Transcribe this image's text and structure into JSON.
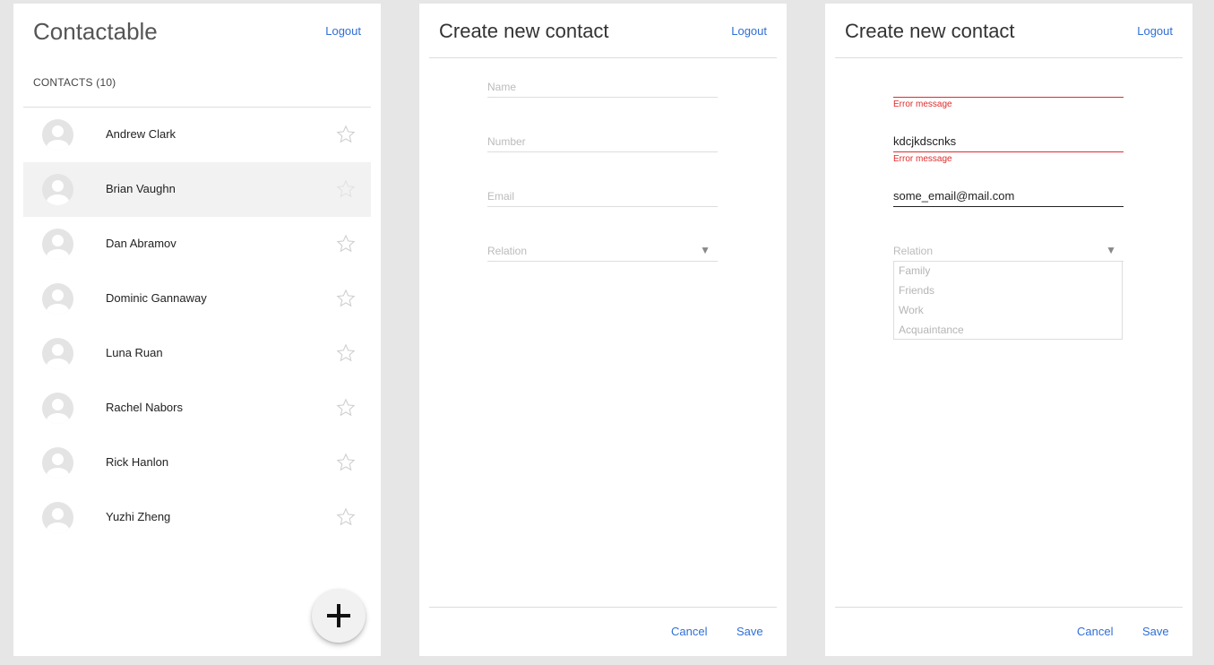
{
  "list_screen": {
    "title": "Contactable",
    "logout_label": "Logout",
    "contacts_header": "CONTACTS (10)",
    "contacts": [
      {
        "name": "Andrew Clark"
      },
      {
        "name": "Brian Vaughn"
      },
      {
        "name": "Dan Abramov"
      },
      {
        "name": "Dominic Gannaway"
      },
      {
        "name": "Luna Ruan"
      },
      {
        "name": "Rachel Nabors"
      },
      {
        "name": "Rick Hanlon"
      },
      {
        "name": "Yuzhi Zheng"
      }
    ],
    "highlighted_contact": "Brian Vaughn",
    "fab_icon": "plus-icon"
  },
  "empty_form": {
    "title": "Create new contact",
    "logout_label": "Logout",
    "name_placeholder": "Name",
    "number_placeholder": "Number",
    "email_placeholder": "Email",
    "relation_placeholder": "Relation",
    "cancel_label": "Cancel",
    "save_label": "Save"
  },
  "filled_form": {
    "title": "Create new contact",
    "logout_label": "Logout",
    "name_value": "",
    "name_error": "Error message",
    "number_value": "kdcjkdscnks",
    "number_error": "Error message",
    "email_value": "some_email@mail.com",
    "relation_placeholder": "Relation",
    "relation_options": [
      "Family",
      "Friends",
      "Work",
      "Acquaintance"
    ],
    "cancel_label": "Cancel",
    "save_label": "Save"
  },
  "colors": {
    "accent": "#2f6fd6",
    "error": "#e02b2b",
    "background": "#e6e6e6",
    "panel": "#ffffff"
  }
}
